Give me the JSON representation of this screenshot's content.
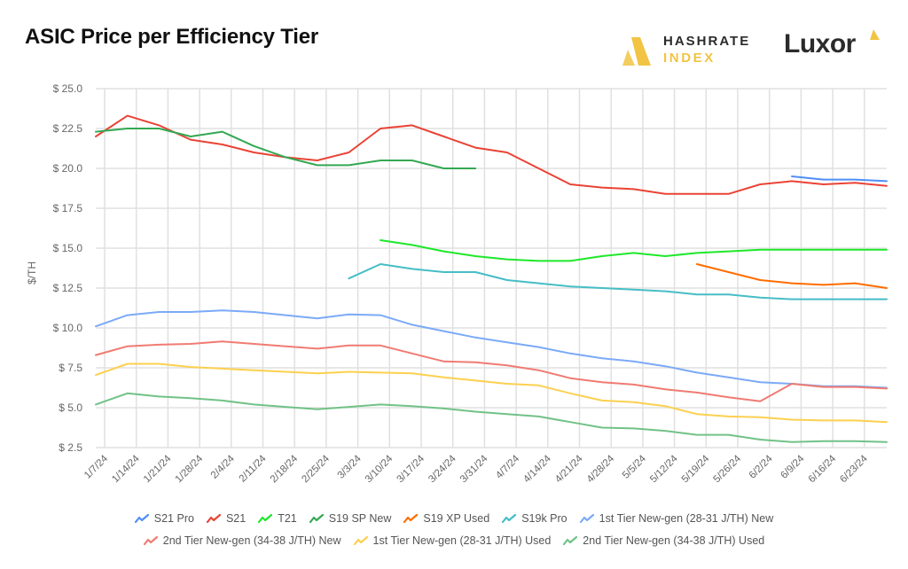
{
  "header": {
    "title": "ASIC Price per Efficiency Tier",
    "logos": {
      "hashrate_index": {
        "line1": "HASHRATE",
        "line2": "INDEX",
        "color": "#f2c443"
      },
      "luxor": {
        "word": "Luxor",
        "accent": "#f2c443"
      }
    }
  },
  "chart_data": {
    "type": "line",
    "title": "ASIC Price per Efficiency Tier",
    "xlabel": "",
    "ylabel": "$/TH",
    "ylim": [
      2.5,
      25.0
    ],
    "yticks": [
      "$ 2.5",
      "$ 5.0",
      "$ 7.5",
      "$ 10.0",
      "$ 12.5",
      "$ 15.0",
      "$ 17.5",
      "$ 20.0",
      "$ 22.5",
      "$ 25.0"
    ],
    "ytick_values": [
      2.5,
      5.0,
      7.5,
      10.0,
      12.5,
      15.0,
      17.5,
      20.0,
      22.5,
      25.0
    ],
    "grid": true,
    "legend_position": "bottom",
    "x_tick_labels": [
      "1/7/24",
      "1/14/24",
      "1/21/24",
      "1/28/24",
      "2/4/24",
      "2/11/24",
      "2/18/24",
      "2/25/24",
      "3/3/24",
      "3/10/24",
      "3/17/24",
      "3/24/24",
      "3/31/24",
      "4/7/24",
      "4/14/24",
      "4/21/24",
      "4/28/24",
      "5/5/24",
      "5/12/24",
      "5/19/24",
      "5/26/24",
      "6/2/24",
      "6/9/24",
      "6/16/24",
      "6/23/24"
    ],
    "point_count": 26,
    "series": [
      {
        "name": "S21 Pro",
        "color": "#4f8ef7",
        "values": [
          null,
          null,
          null,
          null,
          null,
          null,
          null,
          null,
          null,
          null,
          null,
          null,
          null,
          null,
          null,
          null,
          null,
          null,
          null,
          null,
          null,
          null,
          19.5,
          19.3,
          19.3,
          19.2
        ]
      },
      {
        "name": "S21",
        "color": "#ea4335",
        "values": [
          22.0,
          23.3,
          22.7,
          21.8,
          21.5,
          21.0,
          20.7,
          20.5,
          21.0,
          22.5,
          22.7,
          22.0,
          21.3,
          21.0,
          20.0,
          19.0,
          18.8,
          18.7,
          18.4,
          18.4,
          18.4,
          19.0,
          19.2,
          19.0,
          19.1,
          18.9
        ]
      },
      {
        "name": "T21",
        "color": "#1ee82a",
        "values": [
          null,
          null,
          null,
          null,
          null,
          null,
          null,
          null,
          null,
          15.5,
          15.2,
          14.8,
          14.5,
          14.3,
          14.2,
          14.2,
          14.5,
          14.7,
          14.5,
          14.7,
          14.8,
          14.9,
          14.9,
          14.9,
          14.9,
          14.9
        ]
      },
      {
        "name": "S19 SP New",
        "color": "#34a853",
        "values": [
          22.3,
          22.5,
          22.5,
          22.0,
          22.3,
          21.4,
          20.7,
          20.2,
          20.2,
          20.5,
          20.5,
          20.0,
          20.0,
          null,
          null,
          null,
          null,
          null,
          null,
          null,
          null,
          null,
          null,
          null,
          null,
          null
        ]
      },
      {
        "name": "S19 XP Used",
        "color": "#ff6d00",
        "values": [
          null,
          null,
          null,
          null,
          null,
          null,
          null,
          null,
          null,
          null,
          null,
          null,
          null,
          null,
          null,
          null,
          null,
          null,
          null,
          14.0,
          13.5,
          13.0,
          12.8,
          12.7,
          12.8,
          12.5
        ]
      },
      {
        "name": "S19k Pro",
        "color": "#46bdc6",
        "values": [
          null,
          null,
          null,
          null,
          null,
          null,
          null,
          null,
          13.1,
          14.0,
          13.7,
          13.5,
          13.5,
          13.0,
          12.8,
          12.6,
          12.5,
          12.4,
          12.3,
          12.1,
          12.1,
          11.9,
          11.8,
          11.8,
          11.8,
          11.8
        ]
      },
      {
        "name": "1st Tier New-gen (28-31 J/TH) New",
        "color": "#7baaf7",
        "values": [
          10.1,
          10.8,
          11.0,
          11.0,
          11.1,
          11.0,
          10.8,
          10.6,
          10.85,
          10.8,
          10.2,
          9.8,
          9.4,
          9.1,
          8.8,
          8.4,
          8.1,
          7.9,
          7.6,
          7.2,
          6.9,
          6.6,
          6.5,
          6.35,
          6.35,
          6.25
        ]
      },
      {
        "name": "2nd Tier New-gen (34-38 J/TH) New",
        "color": "#f07b72",
        "values": [
          8.3,
          8.85,
          8.95,
          9.0,
          9.15,
          9.0,
          8.85,
          8.7,
          8.9,
          8.9,
          8.4,
          7.9,
          7.85,
          7.65,
          7.35,
          6.85,
          6.6,
          6.45,
          6.15,
          5.95,
          5.65,
          5.4,
          6.5,
          6.3,
          6.3,
          6.2
        ]
      },
      {
        "name": "1st Tier New-gen (28-31 J/TH) Used",
        "color": "#fcd04f",
        "values": [
          7.05,
          7.75,
          7.75,
          7.55,
          7.45,
          7.35,
          7.25,
          7.15,
          7.25,
          7.2,
          7.15,
          6.9,
          6.7,
          6.5,
          6.4,
          5.9,
          5.45,
          5.35,
          5.1,
          4.6,
          4.45,
          4.4,
          4.25,
          4.2,
          4.2,
          4.1
        ]
      },
      {
        "name": "2nd Tier New-gen (34-38 J/TH) Used",
        "color": "#71c287",
        "values": [
          5.2,
          5.9,
          5.7,
          5.6,
          5.45,
          5.2,
          5.05,
          4.9,
          5.05,
          5.2,
          5.1,
          4.95,
          4.75,
          4.6,
          4.45,
          4.1,
          3.75,
          3.7,
          3.55,
          3.3,
          3.3,
          3.0,
          2.85,
          2.9,
          2.9,
          2.85
        ]
      }
    ],
    "legend_rows": [
      [
        "S21 Pro",
        "S21",
        "T21",
        "S19 SP New",
        "S19 XP Used",
        "S19k Pro",
        "1st Tier New-gen (28-31 J/TH) New"
      ],
      [
        "2nd Tier New-gen (34-38 J/TH) New",
        "1st Tier New-gen (28-31 J/TH) Used",
        "2nd Tier New-gen (34-38 J/TH) Used"
      ]
    ]
  }
}
